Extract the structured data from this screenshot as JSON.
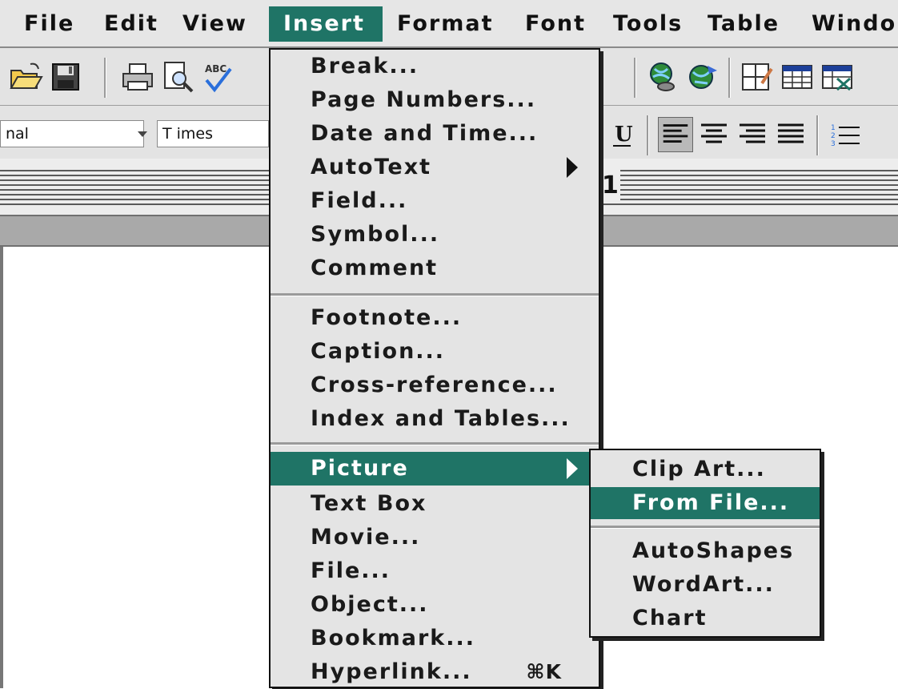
{
  "menubar": {
    "items": [
      {
        "label": "File"
      },
      {
        "label": "Edit"
      },
      {
        "label": "View"
      },
      {
        "label": "Insert",
        "active": true
      },
      {
        "label": "Format"
      },
      {
        "label": "Font"
      },
      {
        "label": "Tools"
      },
      {
        "label": "Table"
      },
      {
        "label": "Windo"
      }
    ]
  },
  "toolbar_format": {
    "style_value": "nal",
    "font_value": "T imes"
  },
  "ruler": {
    "number": "1"
  },
  "insert_menu": {
    "items": [
      {
        "label": "Break..."
      },
      {
        "label": "Page Numbers..."
      },
      {
        "label": "Date and Time..."
      },
      {
        "label": "AutoText",
        "submenu": true
      },
      {
        "label": "Field..."
      },
      {
        "label": "Symbol..."
      },
      {
        "label": "Comment"
      },
      {
        "label": "Footnote..."
      },
      {
        "label": "Caption..."
      },
      {
        "label": "Cross-reference..."
      },
      {
        "label": "Index and Tables..."
      },
      {
        "label": "Picture",
        "submenu": true,
        "highlighted": true
      },
      {
        "label": "Text Box"
      },
      {
        "label": "Movie..."
      },
      {
        "label": "File..."
      },
      {
        "label": "Object..."
      },
      {
        "label": "Bookmark..."
      },
      {
        "label": "Hyperlink...",
        "shortcut": "⌘K"
      }
    ]
  },
  "picture_submenu": {
    "items": [
      {
        "label": "Clip Art..."
      },
      {
        "label": "From File...",
        "highlighted": true
      },
      {
        "label": "AutoShapes"
      },
      {
        "label": "WordArt..."
      },
      {
        "label": "Chart"
      }
    ]
  },
  "colors": {
    "highlight": "#1f7466",
    "menu_bg": "#e4e4e4"
  }
}
